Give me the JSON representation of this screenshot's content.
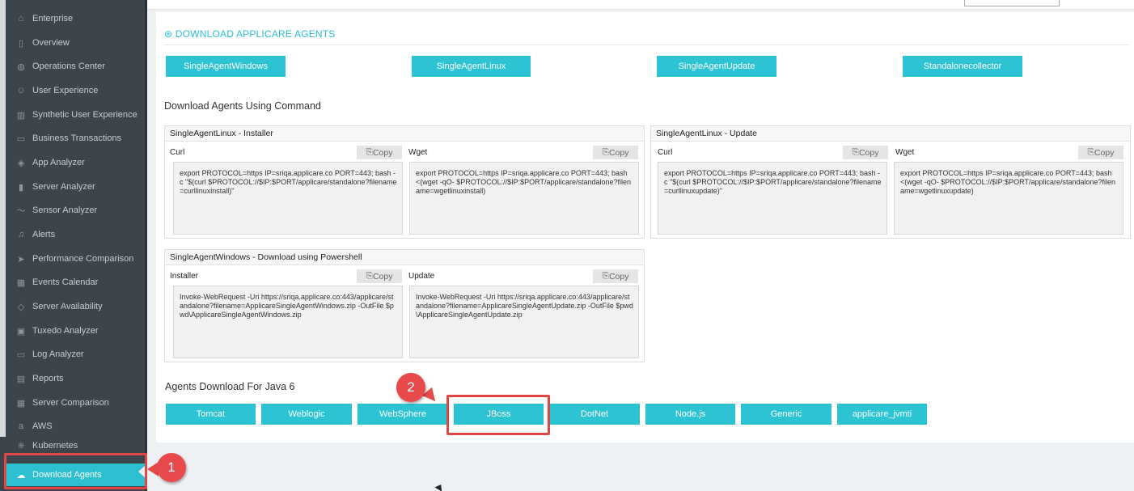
{
  "sidebar": {
    "items": [
      {
        "label": "Enterprise",
        "icon": "home-icon"
      },
      {
        "label": "Overview",
        "icon": "square-icon"
      },
      {
        "label": "Operations Center",
        "icon": "globe-icon"
      },
      {
        "label": "User Experience",
        "icon": "user-icon"
      },
      {
        "label": "Synthetic User Experience",
        "icon": "columns-icon"
      },
      {
        "label": "Business Transactions",
        "icon": "folder-icon"
      },
      {
        "label": "App Analyzer",
        "icon": "layers-icon"
      },
      {
        "label": "Server Analyzer",
        "icon": "bar-chart-icon"
      },
      {
        "label": "Sensor Analyzer",
        "icon": "wave-icon"
      },
      {
        "label": "Alerts",
        "icon": "bell-icon"
      },
      {
        "label": "Performance Comparison",
        "icon": "send-icon"
      },
      {
        "label": "Events Calendar",
        "icon": "calendar-icon"
      },
      {
        "label": "Server Availability",
        "icon": "tag-icon"
      },
      {
        "label": "Tuxedo Analyzer",
        "icon": "briefcase-icon"
      },
      {
        "label": "Log Analyzer",
        "icon": "window-icon"
      },
      {
        "label": "Reports",
        "icon": "report-icon"
      },
      {
        "label": "Server Comparison",
        "icon": "grid-icon"
      },
      {
        "label": "AWS",
        "icon": "aws-icon"
      },
      {
        "label": "Kubernetes",
        "icon": "kubernetes-icon"
      },
      {
        "label": "Download Agents",
        "icon": "cloud-download-icon"
      }
    ]
  },
  "main": {
    "section_title": "DOWNLOAD APPLICARE AGENTS",
    "agent_buttons": [
      "SingleAgentWindows",
      "SingleAgentLinux",
      "SingleAgentUpdate",
      "Standalonecollector"
    ],
    "command_heading": "Download Agents Using Command",
    "copy_label": "Copy",
    "boxes": {
      "linux_installer": {
        "title": "SingleAgentLinux - Installer",
        "left_label": "Curl",
        "left_code": "export PROTOCOL=https IP=sriqa.applicare.co PORT=443; bash -c \"$(curl $PROTOCOL://$IP:$PORT/applicare/standalone?filename=curllinuxinstall)\"",
        "right_label": "Wget",
        "right_code": "export PROTOCOL=https IP=sriqa.applicare.co PORT=443; bash <(wget -qO- $PROTOCOL://$IP:$PORT/applicare/standalone?filename=wgetlinuxinstall)"
      },
      "linux_update": {
        "title": "SingleAgentLinux - Update",
        "left_label": "Curl",
        "left_code": "export PROTOCOL=https IP=sriqa.applicare.co PORT=443; bash -c \"$(curl $PROTOCOL://$IP:$PORT/applicare/standalone?filename=curllinuxupdate)\"",
        "right_label": "Wget",
        "right_code": "export PROTOCOL=https IP=sriqa.applicare.co PORT=443; bash <(wget -qO- $PROTOCOL://$IP:$PORT/applicare/standalone?filename=wgetlinuxupdate)"
      },
      "windows_powershell": {
        "title": "SingleAgentWindows - Download using Powershell",
        "left_label": "Installer",
        "left_code": "Invoke-WebRequest -Uri https://sriqa.applicare.co:443/applicare/standalone?filename=ApplicareSingleAgentWindows.zip -OutFile $pwd\\ApplicareSingleAgentWindows.zip",
        "right_label": "Update",
        "right_code": "Invoke-WebRequest -Uri https://sriqa.applicare.co:443/applicare/standalone?filename=ApplicareSingleAgentUpdate.zip -OutFile $pwd\\ApplicareSingleAgentUpdate.zip"
      }
    },
    "java6_heading": "Agents Download For Java 6",
    "java6_buttons": [
      "Tomcat",
      "Weblogic",
      "WebSphere",
      "JBoss",
      "DotNet",
      "Node.js",
      "Generic",
      "applicare_jvmti"
    ]
  },
  "annotations": {
    "step1": "1",
    "step2": "2"
  },
  "colors": {
    "accent": "#2cc3d3",
    "sidebar_bg": "#3c444c",
    "annotation_red": "#e04646"
  }
}
